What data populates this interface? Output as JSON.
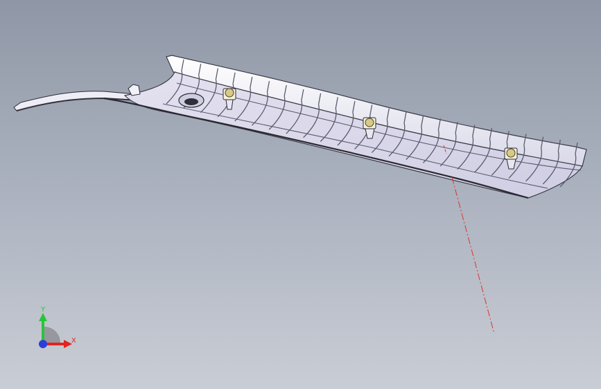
{
  "viewport": {
    "part": "trim-panel",
    "background_top": "#8f97a6",
    "background_bottom": "#c9cdd5",
    "part_color": "#e9e8f3",
    "rib_color": "#6a6a78",
    "clip_color": "#d8c98a",
    "centerline_color": "#e0322a"
  },
  "triad": {
    "x_label": "X",
    "y_label": "Y",
    "x_color": "#e3231f",
    "y_color": "#2ac43a",
    "z_color": "#2b3fd8"
  }
}
